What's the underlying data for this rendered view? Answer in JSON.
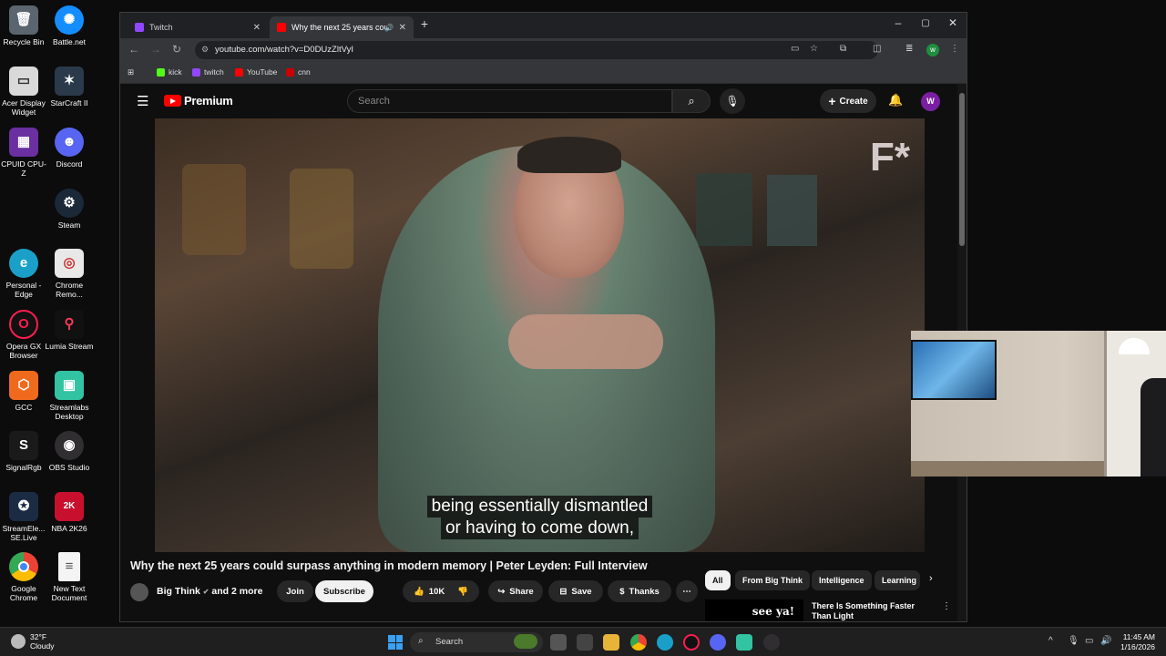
{
  "desktop": {
    "icons": [
      {
        "label": "Recycle Bin",
        "icon": "recycle-bin-icon"
      },
      {
        "label": "Battle.net",
        "icon": "battlenet-icon"
      },
      {
        "label": "Acer Display Widget",
        "icon": "acer-display-icon"
      },
      {
        "label": "StarCraft II",
        "icon": "starcraft-icon"
      },
      {
        "label": "CPUID CPU-Z",
        "icon": "cpuz-icon"
      },
      {
        "label": "Discord",
        "icon": "discord-icon"
      },
      {
        "label": "Steam",
        "icon": "steam-icon"
      },
      {
        "label": "Personal - Edge",
        "icon": "edge-icon"
      },
      {
        "label": "Chrome Remo...",
        "icon": "chrome-remote-icon"
      },
      {
        "label": "Opera GX Browser",
        "icon": "opera-gx-icon"
      },
      {
        "label": "Lumia Stream",
        "icon": "lumia-stream-icon"
      },
      {
        "label": "GCC",
        "icon": "gcc-icon"
      },
      {
        "label": "Streamlabs Desktop",
        "icon": "streamlabs-icon"
      },
      {
        "label": "SignalRgb",
        "icon": "signalrgb-icon"
      },
      {
        "label": "OBS Studio",
        "icon": "obs-icon"
      },
      {
        "label": "StreamEle... SE.Live",
        "icon": "streamelements-icon"
      },
      {
        "label": "NBA 2K26",
        "icon": "nba2k-icon"
      },
      {
        "label": "Google Chrome",
        "icon": "chrome-icon"
      },
      {
        "label": "New Text Document",
        "icon": "text-document-icon"
      }
    ]
  },
  "browser": {
    "tabs": [
      {
        "label": "Twitch",
        "active": false
      },
      {
        "label": "Why the next 25 years cou",
        "active": true
      }
    ],
    "url": "youtube.com/watch?v=D0DUzZltVyI",
    "bookmarks": [
      "kick",
      "twitch",
      "YouTube",
      "cnn"
    ],
    "profile_initial": "w"
  },
  "youtube": {
    "logo_text": "Premium",
    "search_placeholder": "Search",
    "create_label": "Create",
    "avatar_initial": "W",
    "watermark": "F*",
    "caption_line1": "being essentially dismantled",
    "caption_line2": "or having to come down,",
    "video_title": "Why the next 25 years could surpass anything in modern memory | Peter Leyden: Full Interview",
    "channel_name": "Big Think",
    "channel_more": "and 2 more",
    "join_label": "Join",
    "subscribe_label": "Subscribe",
    "like_count": "10K",
    "share_label": "Share",
    "save_label": "Save",
    "thanks_label": "Thanks",
    "chips": [
      "All",
      "From Big Think",
      "Intelligence",
      "Learning"
    ],
    "reco_thumb_text": "see ya!",
    "reco_title": "There Is Something Faster Than Light"
  },
  "taskbar": {
    "weather_temp": "32°F",
    "weather_desc": "Cloudy",
    "search_label": "Search",
    "time": "11:45 AM",
    "date": "1/16/2026"
  },
  "colors": {
    "yt_red": "#ff0000",
    "avatar_purple": "#7b1fa2",
    "win_accent": "#3aa0f2"
  }
}
